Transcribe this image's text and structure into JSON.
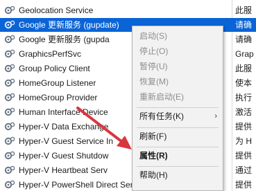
{
  "services": [
    {
      "name": "Geolocation Service",
      "desc": "此服",
      "selected": false
    },
    {
      "name": "Google 更新服务 (gupdate)",
      "desc": "请确",
      "selected": true
    },
    {
      "name": "Google 更新服务 (gupda",
      "desc": "请确",
      "selected": false
    },
    {
      "name": "GraphicsPerfSvc",
      "desc": "Grap",
      "selected": false
    },
    {
      "name": "Group Policy Client",
      "desc": "此服",
      "selected": false
    },
    {
      "name": "HomeGroup Listener",
      "desc": "使本",
      "selected": false
    },
    {
      "name": "HomeGroup Provider",
      "desc": "执行",
      "selected": false
    },
    {
      "name": "Human Interface Device",
      "desc": "激活",
      "selected": false
    },
    {
      "name": "Hyper-V Data Exchange",
      "desc": "提供",
      "selected": false
    },
    {
      "name": "Hyper-V Guest Service In",
      "desc": "为 H",
      "selected": false
    },
    {
      "name": "Hyper-V Guest Shutdow",
      "desc": "提供",
      "selected": false
    },
    {
      "name": "Hyper-V Heartbeat Serv",
      "desc": "通过",
      "selected": false
    },
    {
      "name": "Hyper-V PowerShell Direct Service",
      "desc": "提供",
      "selected": false
    }
  ],
  "context_menu": {
    "start": "启动(S)",
    "stop": "停止(O)",
    "pause": "暂停(U)",
    "resume": "恢复(M)",
    "restart": "重新启动(E)",
    "all_tasks": "所有任务(K)",
    "refresh": "刷新(F)",
    "properties": "属性(R)",
    "help": "帮助(H)"
  },
  "colors": {
    "selection": "#0a64d6",
    "annotation_arrow": "#d9363e"
  },
  "icons": {
    "service": "gear-icon",
    "submenu": "chevron-right-icon"
  }
}
